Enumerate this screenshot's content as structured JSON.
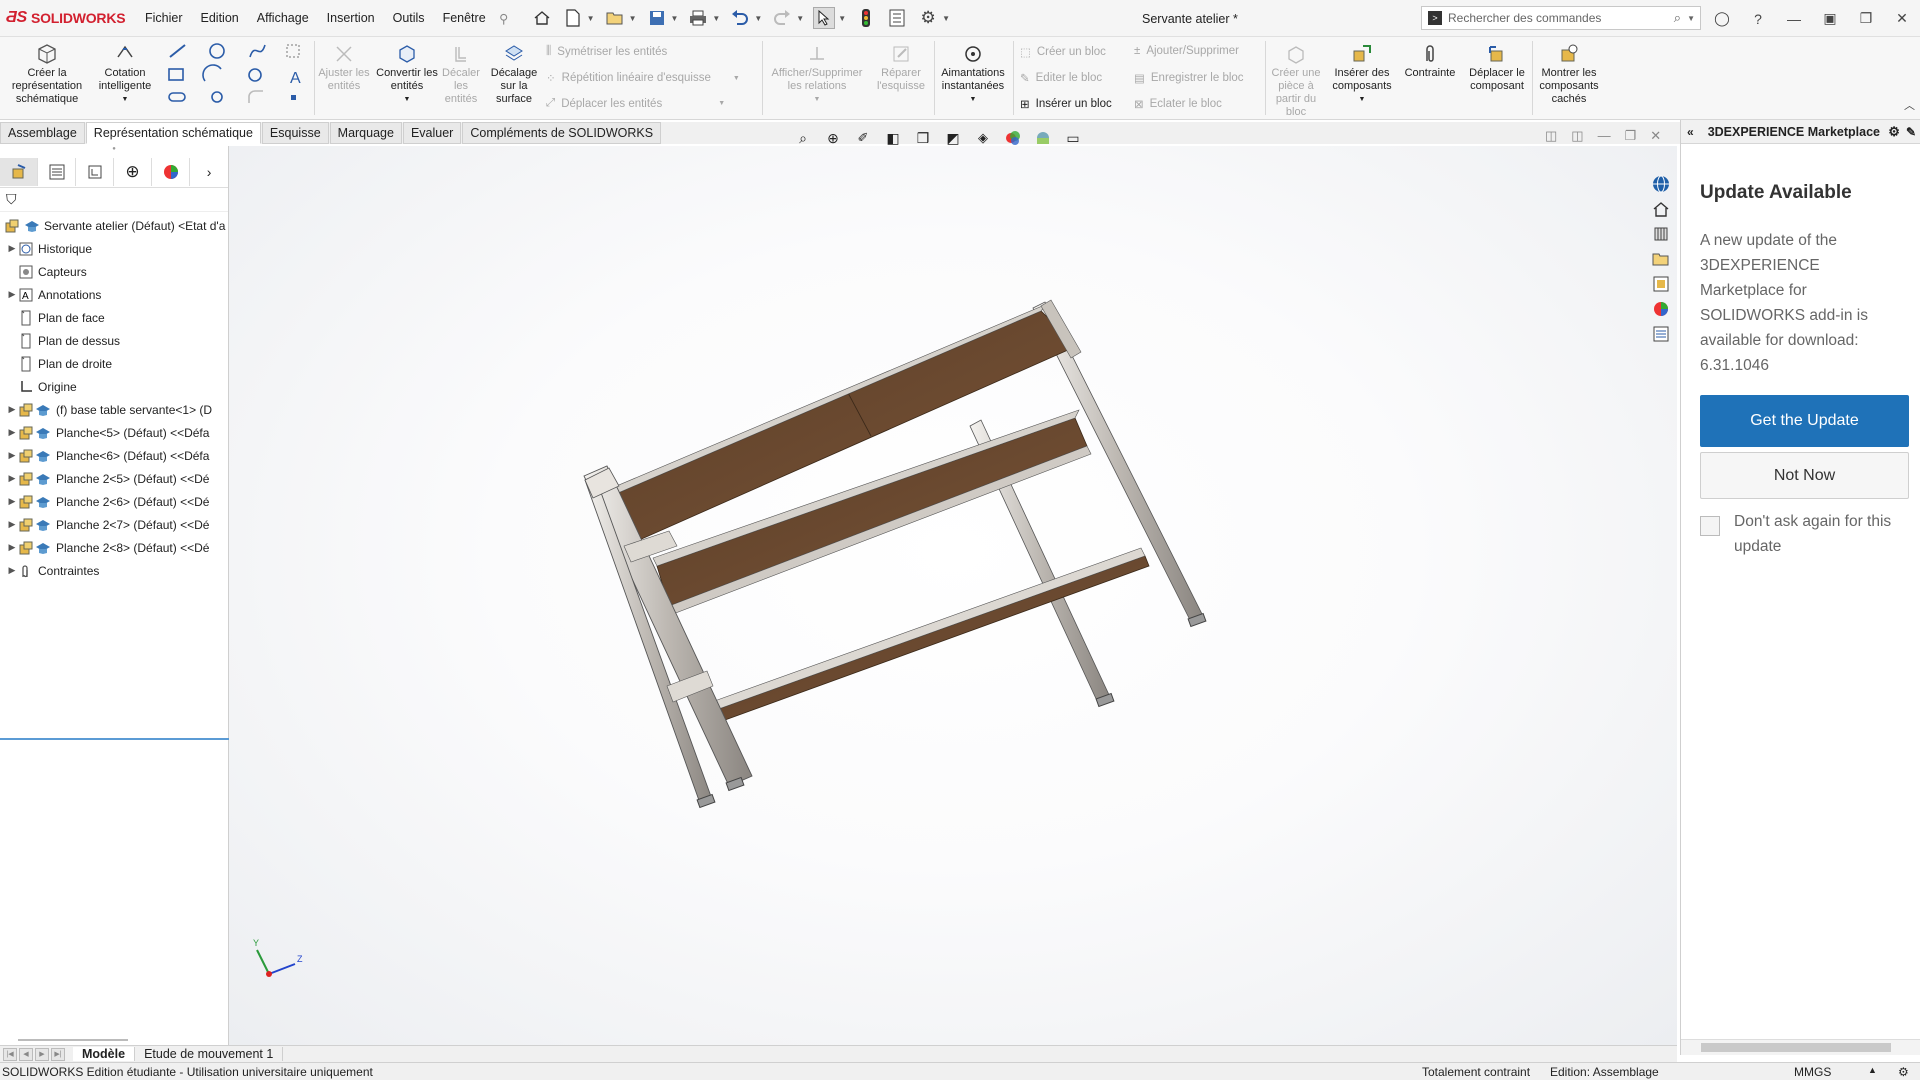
{
  "app": {
    "brand": "SOLIDWORKS",
    "document_title": "Servante atelier *"
  },
  "menu": [
    "Fichier",
    "Edition",
    "Affichage",
    "Insertion",
    "Outils",
    "Fenêtre"
  ],
  "search": {
    "placeholder": "Rechercher des commandes"
  },
  "ribbon": {
    "create_schematic": "Créer la représentation schématique",
    "smart_dimension": "Cotation intelligente",
    "trim": "Ajuster les entités",
    "convert": "Convertir les entités",
    "offset": "Décaler les entités",
    "offset_surface": "Décalage sur la surface",
    "mirror": "Symétriser les entités",
    "linear_pattern": "Répétition linéaire d'esquisse",
    "move": "Déplacer les entités",
    "show_relations": "Afficher/Supprimer les relations",
    "repair": "Réparer l'esquisse",
    "quick_snaps": "Aimantations instantanées",
    "create_block": "Créer un bloc",
    "edit_block": "Editer le bloc",
    "insert_block": "Insérer un bloc",
    "add_remove": "Ajouter/Supprimer",
    "save_block": "Enregistrer le bloc",
    "explode_block": "Eclater le bloc",
    "create_part": "Créer une pièce à partir du bloc",
    "insert_components": "Insérer des composants",
    "mate": "Contrainte",
    "move_component": "Déplacer le composant",
    "show_hidden": "Montrer les composants cachés"
  },
  "tabs": [
    "Assemblage",
    "Représentation schématique",
    "Esquisse",
    "Marquage",
    "Evaluer",
    "Compléments de SOLIDWORKS"
  ],
  "active_tab": "Représentation schématique",
  "tree": {
    "root": "Servante atelier (Défaut) <Etat d'a",
    "items": [
      {
        "label": "Historique",
        "expand": "▶",
        "icon": "history-icon"
      },
      {
        "label": "Capteurs",
        "expand": "",
        "icon": "sensor-icon"
      },
      {
        "label": "Annotations",
        "expand": "▶",
        "icon": "annotation-icon"
      },
      {
        "label": "Plan de face",
        "expand": "",
        "icon": "plane-icon"
      },
      {
        "label": "Plan de dessus",
        "expand": "",
        "icon": "plane-icon"
      },
      {
        "label": "Plan de droite",
        "expand": "",
        "icon": "plane-icon"
      },
      {
        "label": "Origine",
        "expand": "",
        "icon": "origin-icon"
      },
      {
        "label": "(f) base table servante<1> (D",
        "expand": "▶",
        "icon": "component-icon"
      },
      {
        "label": "Planche<5> (Défaut) <<Défa",
        "expand": "▶",
        "icon": "component-icon"
      },
      {
        "label": "Planche<6> (Défaut) <<Défa",
        "expand": "▶",
        "icon": "component-icon"
      },
      {
        "label": "Planche 2<5> (Défaut) <<Dé",
        "expand": "▶",
        "icon": "component-icon"
      },
      {
        "label": "Planche 2<6> (Défaut) <<Dé",
        "expand": "▶",
        "icon": "component-icon"
      },
      {
        "label": "Planche 2<7> (Défaut) <<Dé",
        "expand": "▶",
        "icon": "component-icon"
      },
      {
        "label": "Planche 2<8> (Défaut) <<Dé",
        "expand": "▶",
        "icon": "component-icon"
      },
      {
        "label": "Contraintes",
        "expand": "▶",
        "icon": "mates-icon"
      }
    ]
  },
  "task_pane": {
    "title": "3DEXPERIENCE Marketplace",
    "update_title": "Update Available",
    "update_text": "A new update of the 3DEXPERIENCE Marketplace for SOLIDWORKS add-in is available for download: 6.31.1046",
    "get_button": "Get the Update",
    "not_now_button": "Not Now",
    "dont_ask": "Don't ask again for this update"
  },
  "bottom_tabs": [
    "Modèle",
    "Etude de mouvement 1"
  ],
  "status": {
    "left": "SOLIDWORKS Edition étudiante - Utilisation universitaire uniquement",
    "constraint": "Totalement contraint",
    "edition": "Edition: Assemblage",
    "units": "MMGS"
  },
  "triad": {
    "x": "Y",
    "z": "Z"
  },
  "colors": {
    "brand": "#d2202f",
    "accent": "#1f72b8",
    "wood": "#6b4a30",
    "frame": "#d8d4cf"
  }
}
